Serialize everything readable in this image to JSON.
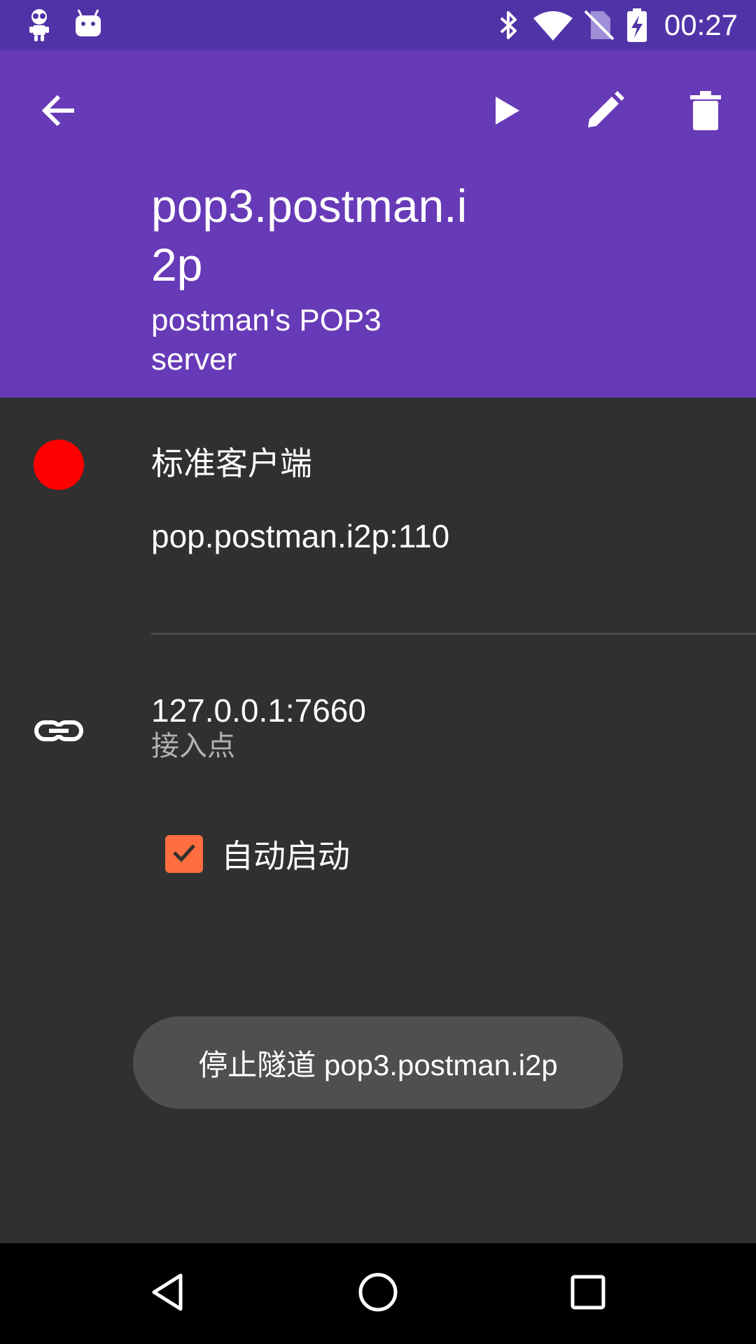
{
  "status_bar": {
    "time": "00:27",
    "left_icons": [
      "robot-notification-icon",
      "android-notification-icon"
    ],
    "right_icons": [
      "bluetooth-icon",
      "wifi-icon",
      "no-sim-icon",
      "battery-charging-icon"
    ]
  },
  "app_bar": {
    "back_icon": "arrow-back-icon",
    "actions": [
      "play-icon",
      "edit-icon",
      "delete-icon"
    ],
    "title": "pop3.postman.i2p",
    "subtitle": "postman's POP3 server",
    "color": "#673ab7"
  },
  "tunnel": {
    "status_color": "#ff0000",
    "client_type": "标准客户端",
    "target": "pop.postman.i2p:110",
    "endpoint": "127.0.0.1:7660",
    "endpoint_label": "接入点",
    "autostart_label": "自动启动",
    "autostart_checked": true
  },
  "toast": {
    "message": "停止隧道 pop3.postman.i2p"
  },
  "nav_bar": {
    "buttons": [
      "back-nav-icon",
      "home-nav-icon",
      "recents-nav-icon"
    ]
  }
}
